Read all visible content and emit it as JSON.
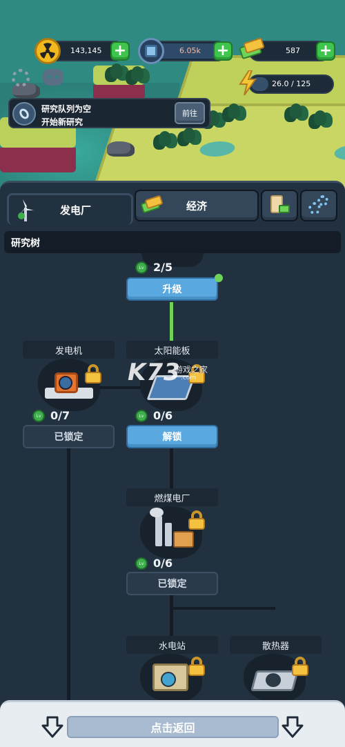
{
  "resources": {
    "research": {
      "value": "143,145",
      "icon": "radiation-icon"
    },
    "chips": {
      "value": "6.05k",
      "icon": "chip-icon"
    },
    "cash": {
      "value": "587",
      "icon": "money-icon"
    },
    "energy": {
      "value": "26.0 / 125",
      "icon": "lightning-icon",
      "fill_fraction": 0.21
    }
  },
  "notification": {
    "line1": "研究队列为空",
    "line2": "开始新研究",
    "button": "前往"
  },
  "tabs": [
    {
      "label": "发电厂",
      "icon": "windmill-icon",
      "active": true
    },
    {
      "label": "经济",
      "icon": "money-icon",
      "active": false
    },
    {
      "label": "",
      "icon": "scroll-money-icon",
      "active": false
    },
    {
      "label": "",
      "icon": "gears-icon",
      "active": false
    }
  ],
  "tree_header": "研究树",
  "nodes": {
    "top": {
      "level": "2/5",
      "button": "升级"
    },
    "generator": {
      "title": "发电机",
      "level": "0/7",
      "button": "已锁定"
    },
    "solar": {
      "title": "太阳能板",
      "level": "0/6",
      "button": "解锁"
    },
    "coal": {
      "title": "燃煤电厂",
      "level": "0/6",
      "button": "已锁定"
    },
    "hydro": {
      "title": "水电站"
    },
    "radiator": {
      "title": "散热器"
    }
  },
  "watermark": {
    "main": "K73",
    "sub": "游戏之家",
    "url": ".com"
  },
  "bottom": {
    "button": "点击返回"
  },
  "colors": {
    "accent_green": "#3fc54d",
    "button_blue": "#5aa8e0",
    "panel_bg": "#22313f",
    "lock_gold": "#f4c23f"
  }
}
